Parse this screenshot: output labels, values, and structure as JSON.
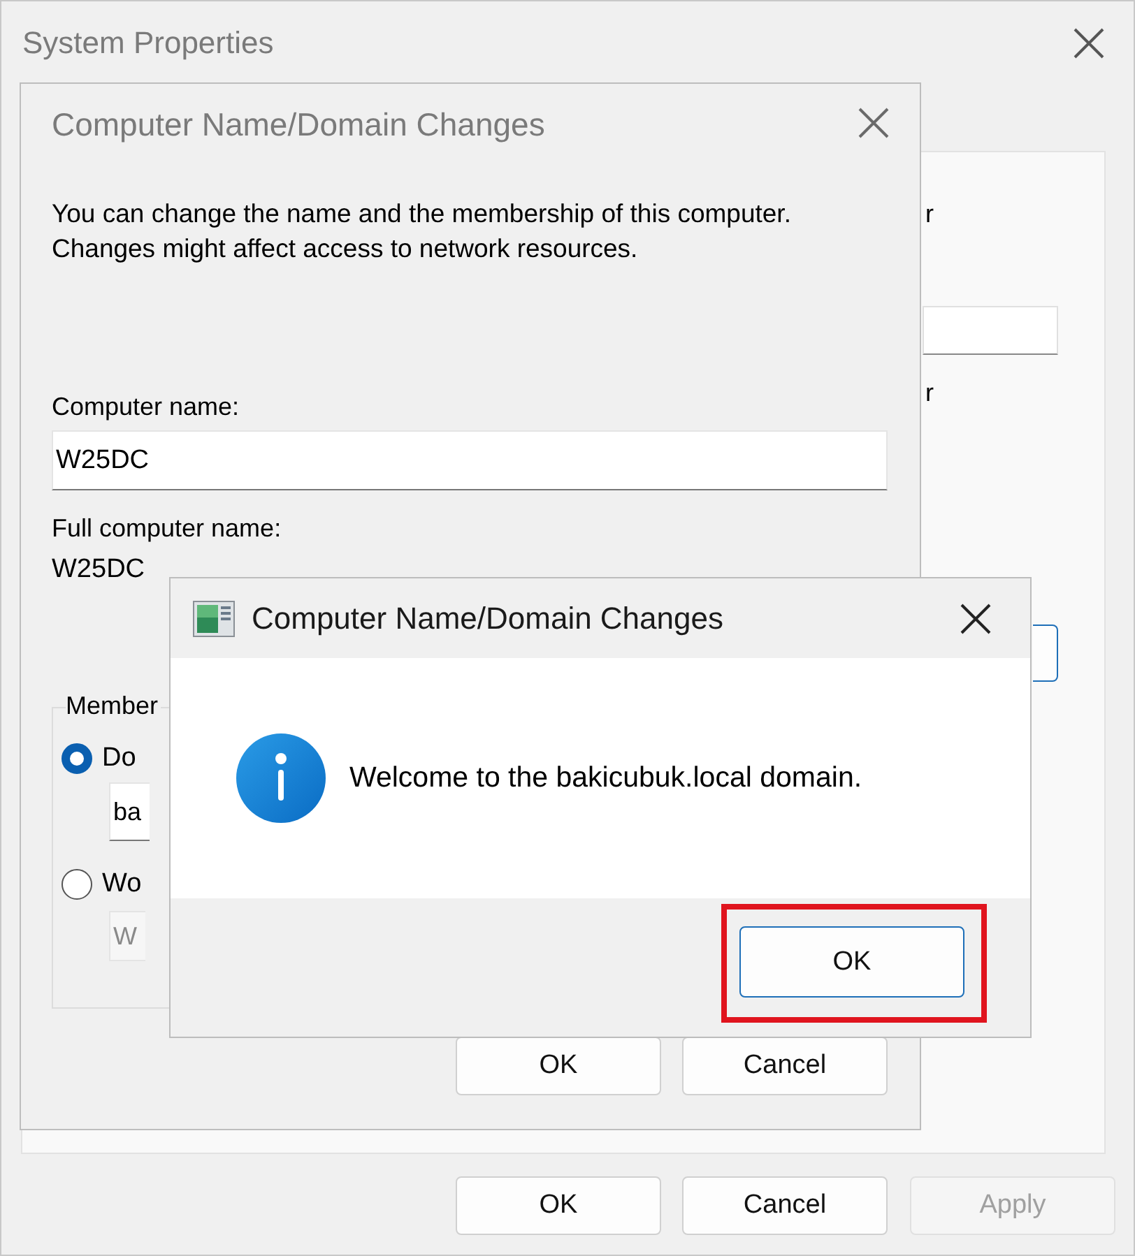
{
  "system_properties": {
    "title": "System Properties",
    "partial_labels": [
      "r",
      "r"
    ],
    "buttons": [
      {
        "label": "OK",
        "disabled": false
      },
      {
        "label": "Cancel",
        "disabled": false
      },
      {
        "label": "Apply",
        "disabled": true
      }
    ]
  },
  "name_changes": {
    "title": "Computer Name/Domain Changes",
    "description": "You can change the name and the membership of this computer. Changes might affect access to network resources.",
    "computer_name_label": "Computer name:",
    "computer_name": "W25DC",
    "full_name_label": "Full computer name:",
    "full_name": "W25DC",
    "member_of": {
      "label": "Member",
      "options": [
        {
          "label": "Do",
          "selected": true,
          "value": "ba"
        },
        {
          "label": "Wo",
          "selected": false,
          "value": "W"
        }
      ]
    },
    "buttons": [
      "OK",
      "Cancel"
    ]
  },
  "message_box": {
    "title": "Computer Name/Domain Changes",
    "message": "Welcome to the bakicubuk.local domain.",
    "button": {
      "label": "OK",
      "highlighted": true
    }
  }
}
